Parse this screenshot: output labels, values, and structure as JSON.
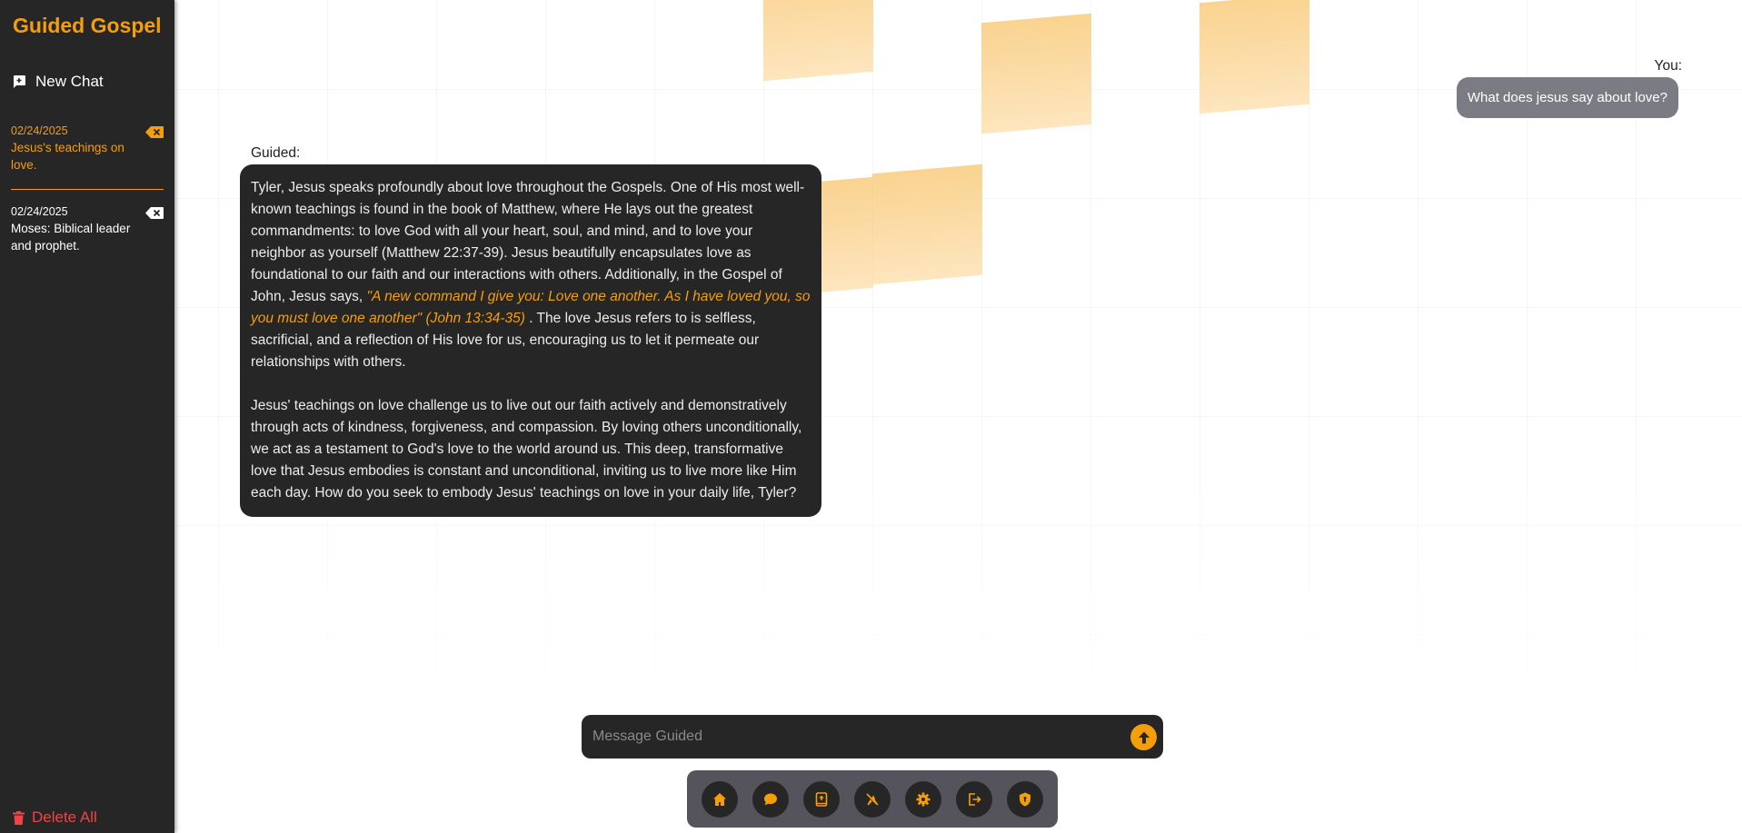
{
  "app": {
    "brand": "Guided Gospel"
  },
  "sidebar": {
    "new_chat_label": "New Chat",
    "conversations": [
      {
        "date": "02/24/2025",
        "title": "Jesus's teachings on love.",
        "active": true
      },
      {
        "date": "02/24/2025",
        "title": "Moses: Biblical leader and prophet.",
        "active": false
      }
    ],
    "delete_all_label": "Delete All"
  },
  "chat": {
    "user_label": "You:",
    "user_message": "What does jesus say about love?",
    "bot_label": "Guided:",
    "bot_p1_before": "Tyler, Jesus speaks profoundly about love throughout the Gospels. One of His most well-known teachings is found in the book of Matthew, where He lays out the greatest commandments: to love God with all your heart, soul, and mind, and to love your neighbor as yourself (Matthew 22:37-39). Jesus beautifully encapsulates love as foundational to our faith and our interactions with others. Additionally, in the Gospel of John, Jesus says, ",
    "bot_p1_quote": "\"A new command I give you: Love one another. As I have loved you, so you must love one another\" (John 13:34-35)",
    "bot_p1_after": " . The love Jesus refers to is selfless, sacrificial, and a reflection of His love for us, encouraging us to let it permeate our relationships with others.",
    "bot_p2": "Jesus' teachings on love challenge us to live out our faith actively and demonstratively through acts of kindness, forgiveness, and compassion. By loving others unconditionally, we act as a testament to God's love to the world around us. This deep, transformative love that Jesus embodies is constant and unconditional, inviting us to live more like Him each day. How do you seek to embody Jesus' teachings on love in your daily life, Tyler?"
  },
  "composer": {
    "placeholder": "Message Guided",
    "value": ""
  },
  "toolbar": {
    "icons": [
      "home-icon",
      "chat-bubble-icon",
      "bible-book-icon",
      "prayer-icon",
      "gear-icon",
      "logout-icon",
      "shield-icon"
    ]
  },
  "colors": {
    "accent": "#f59e0b",
    "sidebar_bg": "#262626",
    "danger": "#ef4444",
    "user_bubble": "#7b7b83"
  }
}
